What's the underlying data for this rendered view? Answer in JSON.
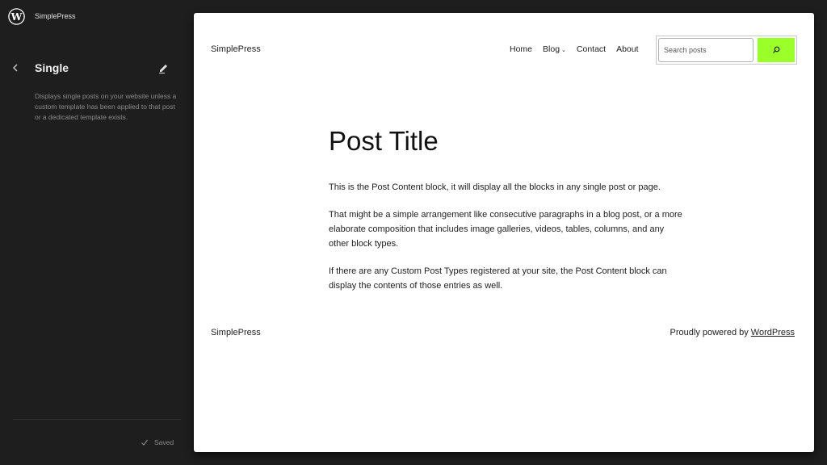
{
  "sidebar": {
    "site_name": "SimplePress",
    "panel_title": "Single",
    "description": "Displays single posts on your website unless a custom template has been applied to that post or a dedicated template exists.",
    "saved_label": "Saved",
    "icons": {
      "logo": "wordpress-logo-icon",
      "back": "chevron-left-icon",
      "edit": "pencil-icon",
      "saved": "check-icon"
    }
  },
  "canvas": {
    "header": {
      "site_title": "SimplePress",
      "nav": [
        {
          "label": "Home"
        },
        {
          "label": "Blog",
          "has_submenu": true
        },
        {
          "label": "Contact"
        },
        {
          "label": "About"
        }
      ],
      "search": {
        "placeholder": "Search posts",
        "value": "",
        "button_icon": "search-icon",
        "button_color": "#9bff2a"
      }
    },
    "post": {
      "title": "Post Title",
      "paragraphs": [
        "This is the Post Content block, it will display all the blocks in any single post or page.",
        "That might be a simple arrangement like consecutive paragraphs in a blog post, or a more elaborate composition that includes image galleries, videos, tables, columns, and any other block types.",
        "If there are any Custom Post Types registered at your site, the Post Content block can display the contents of those entries as well."
      ]
    },
    "footer": {
      "site_title": "SimplePress",
      "credit_prefix": "Proudly powered by ",
      "credit_link": "WordPress"
    }
  }
}
